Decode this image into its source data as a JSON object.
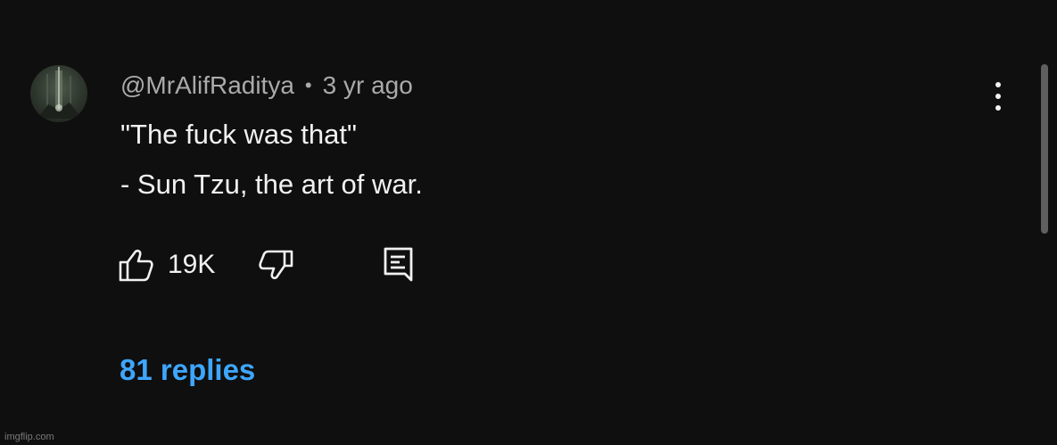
{
  "comment": {
    "author": "@MrAlifRaditya",
    "separator": "•",
    "time_ago": "3 yr ago",
    "text_lines": [
      "\"The fuck was that\"",
      "- Sun Tzu, the art of war."
    ],
    "like_count": "19K",
    "replies_label": "81 replies"
  },
  "icons": {
    "like": "thumbs-up-icon",
    "dislike": "thumbs-down-icon",
    "reply": "reply-icon",
    "more": "more-vertical-icon"
  },
  "colors": {
    "background": "#0f0f0f",
    "text_primary": "#f1f1f1",
    "text_secondary": "#aaaaaa",
    "link": "#3ea6ff"
  },
  "watermark": "imgflip.com"
}
